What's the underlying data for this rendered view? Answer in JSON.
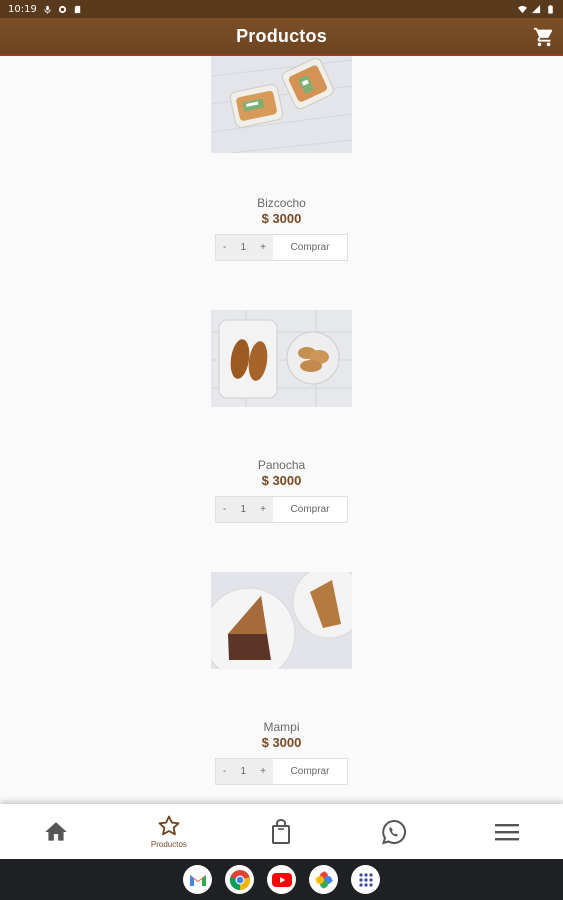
{
  "status_bar": {
    "time": "10:19"
  },
  "app_bar": {
    "title": "Productos",
    "cart_icon": "cart-icon"
  },
  "products": [
    {
      "name": "Bizcocho",
      "price": "$ 3000",
      "qty": "1",
      "minus": "-",
      "plus": "+",
      "buy_label": "Comprar"
    },
    {
      "name": "Panocha",
      "price": "$ 3000",
      "qty": "1",
      "minus": "-",
      "plus": "+",
      "buy_label": "Comprar"
    },
    {
      "name": "Mampi",
      "price": "$ 3000",
      "qty": "1",
      "minus": "-",
      "plus": "+",
      "buy_label": "Comprar"
    }
  ],
  "bottom_nav": {
    "items": [
      {
        "icon": "home-icon",
        "label": ""
      },
      {
        "icon": "star-icon",
        "label": "Productos",
        "active": true
      },
      {
        "icon": "bag-icon",
        "label": ""
      },
      {
        "icon": "whatsapp-icon",
        "label": ""
      },
      {
        "icon": "menu-icon",
        "label": ""
      }
    ]
  },
  "colors": {
    "primary": "#6d4320",
    "accent_line": "#a2391f",
    "price": "#7a4a22"
  }
}
